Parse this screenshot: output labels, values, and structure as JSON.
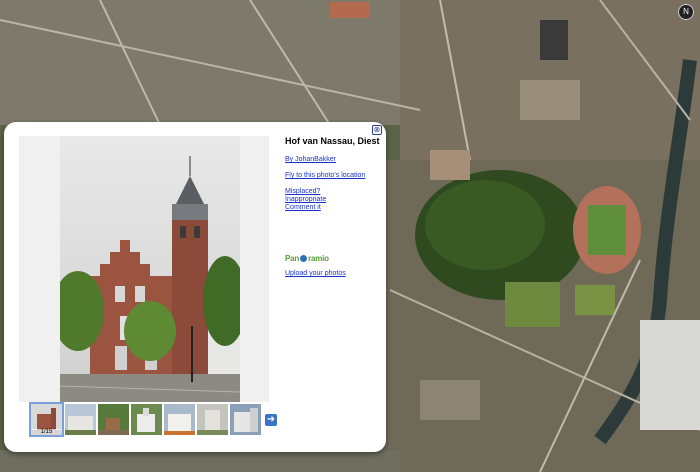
{
  "map": {
    "compass_label": "N"
  },
  "balloon": {
    "close_label": "⊗",
    "title": "Hof van Nassau, Diest",
    "author_link": "By JohanBakker",
    "fly_link": "Fly to this photo's location",
    "report_links": [
      "Misplaced?",
      "Inappropriate",
      "Comment it"
    ],
    "logo_prefix": "Pan",
    "logo_suffix": "ramio",
    "upload_link": "Upload your photos",
    "thumbnail_counter": "1/15",
    "next_label": "➜"
  },
  "colors": {
    "link": "#1a33cc",
    "logo_green": "#5a9b3a",
    "balloon_bg": "#ffffff"
  }
}
